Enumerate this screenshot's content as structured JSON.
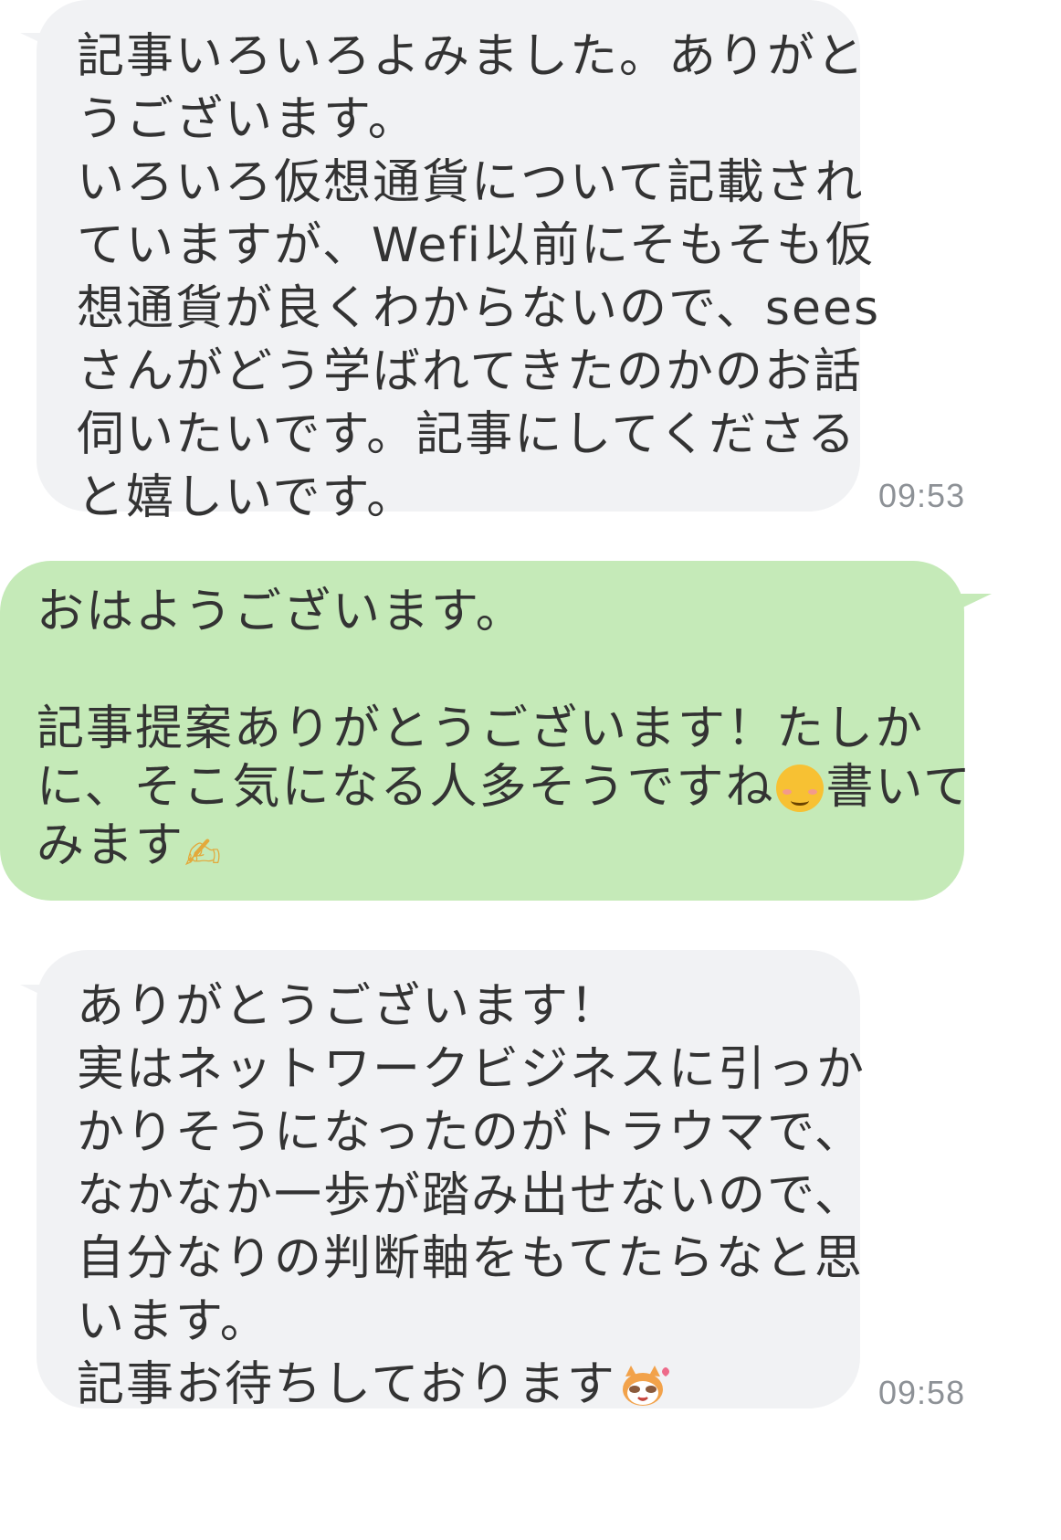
{
  "messages": [
    {
      "direction": "incoming",
      "lines": [
        "記事いろいろよみました。ありがと",
        "うございます。",
        "いろいろ仮想通貨について記載され",
        "ていますが、Wefi以前にそもそも仮",
        "想通貨が良くわからないので、sees",
        "さんがどう学ばれてきたのかのお話",
        "伺いたいです。記事にしてくださる",
        "と嬉しいです。"
      ],
      "time": "09:53"
    },
    {
      "direction": "outgoing",
      "lines": [
        "おはようございます。",
        "",
        "記事提案ありがとうございます！たしか",
        "に、そこ気になる人多そうですね",
        "書いて",
        "みます"
      ],
      "emoji": [
        "smiling-face-icon",
        "writing-hand-icon"
      ]
    },
    {
      "direction": "incoming",
      "lines": [
        "ありがとうございます！",
        "実はネットワークビジネスに引っか",
        "かりそうになったのがトラウマで、",
        "なかなか一歩が踏み出せないので、",
        "自分なりの判断軸をもてたらなと思",
        "います。",
        "記事お待ちしております"
      ],
      "sticker": "raccoon-sticker-icon",
      "time": "09:58"
    }
  ],
  "colors": {
    "incoming_bubble": "#f1f2f4",
    "outgoing_bubble": "#c5eab8",
    "text": "#333333",
    "timestamp": "#8d9196"
  }
}
